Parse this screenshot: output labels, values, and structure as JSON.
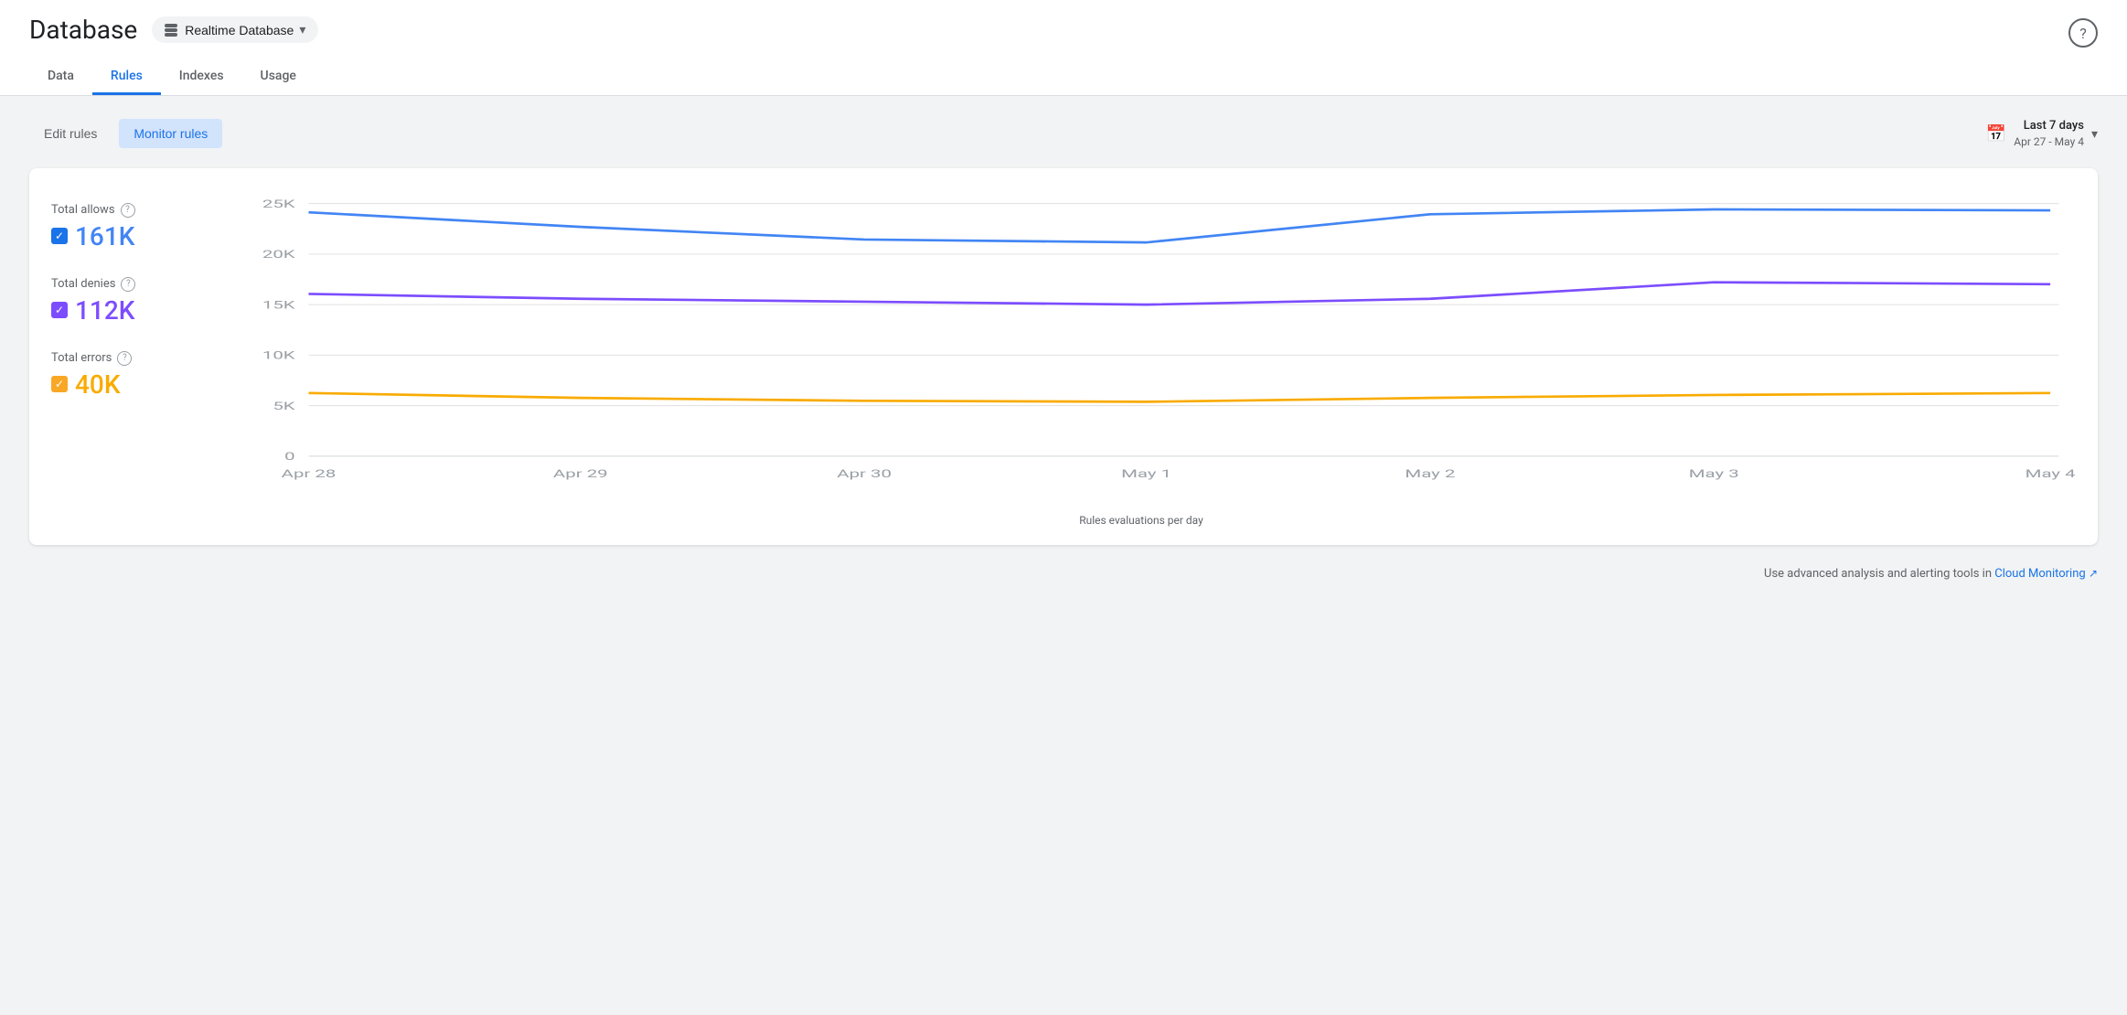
{
  "page": {
    "title": "Database",
    "help_icon": "?"
  },
  "db_selector": {
    "label": "Realtime Database",
    "icon": "stacked-layers-icon"
  },
  "tabs": [
    {
      "id": "data",
      "label": "Data",
      "active": false
    },
    {
      "id": "rules",
      "label": "Rules",
      "active": true
    },
    {
      "id": "indexes",
      "label": "Indexes",
      "active": false
    },
    {
      "id": "usage",
      "label": "Usage",
      "active": false
    }
  ],
  "toolbar": {
    "edit_rules_label": "Edit rules",
    "monitor_rules_label": "Monitor rules",
    "date_label": "Last 7 days",
    "date_sub": "Apr 27 - May 4",
    "dropdown_icon": "chevron-down"
  },
  "chart": {
    "y_labels": [
      "25K",
      "20K",
      "15K",
      "10K",
      "5K",
      "0"
    ],
    "x_labels": [
      "Apr 28",
      "Apr 29",
      "Apr 30",
      "May 1",
      "May 2",
      "May 3",
      "May 4"
    ],
    "x_axis_label": "Rules evaluations per day",
    "series": [
      {
        "id": "allows",
        "label": "Total allows",
        "value": "161K",
        "color": "#4285f4",
        "checkbox_color": "cb-blue",
        "checked": true,
        "points": [
          24200,
          22800,
          21400,
          21100,
          21000,
          24500,
          25000,
          24900
        ]
      },
      {
        "id": "denies",
        "label": "Total denies",
        "value": "112K",
        "color": "#7c4dff",
        "checkbox_color": "cb-purple",
        "checked": true,
        "points": [
          16000,
          15600,
          15400,
          15200,
          15000,
          15800,
          17200,
          17000
        ]
      },
      {
        "id": "errors",
        "label": "Total errors",
        "value": "40K",
        "color": "#f9ab00",
        "checkbox_color": "cb-yellow",
        "checked": true,
        "points": [
          6200,
          5800,
          5600,
          5500,
          5400,
          5800,
          6100,
          6200
        ]
      }
    ]
  },
  "footer": {
    "text": "Use advanced analysis and alerting tools in ",
    "link_label": "Cloud Monitoring",
    "ext_icon": "external-link-icon"
  }
}
